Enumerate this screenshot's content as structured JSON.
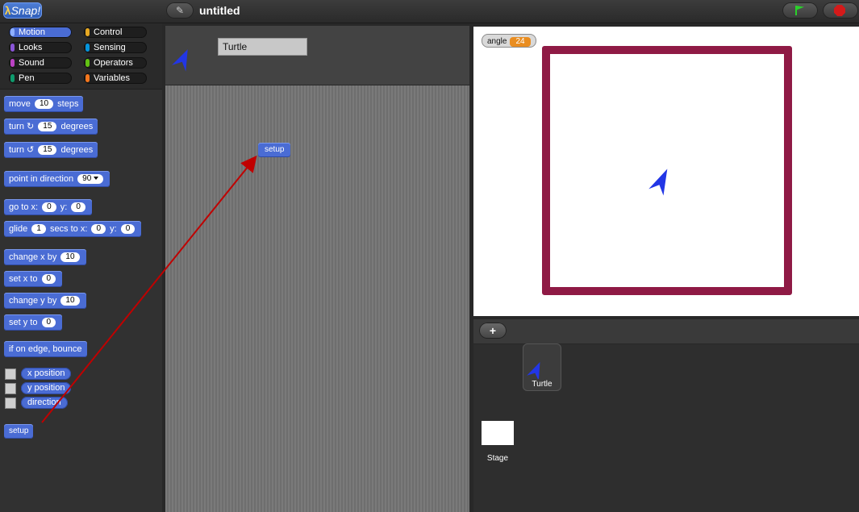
{
  "header": {
    "logo": "Snap!",
    "project_title": "untitled",
    "pencil_icon": "pencil-icon",
    "flag_icon": "green-flag-icon",
    "stop_icon": "stop-sign-icon"
  },
  "categories": [
    {
      "label": "Motion",
      "color": "#4a6cd4",
      "active": true
    },
    {
      "label": "Looks",
      "color": "#8a55d7"
    },
    {
      "label": "Sound",
      "color": "#bb42c3"
    },
    {
      "label": "Pen",
      "color": "#0e9a6c"
    },
    {
      "label": "Control",
      "color": "#e6a822"
    },
    {
      "label": "Sensing",
      "color": "#0494dc"
    },
    {
      "label": "Operators",
      "color": "#62c213"
    },
    {
      "label": "Variables",
      "color": "#f3761d"
    }
  ],
  "blocks": {
    "move": {
      "pre": "move",
      "val": "10",
      "post": "steps"
    },
    "turn_cw": {
      "pre": "turn ↻",
      "val": "15",
      "post": "degrees"
    },
    "turn_ccw": {
      "pre": "turn ↺",
      "val": "15",
      "post": "degrees"
    },
    "point": {
      "pre": "point in direction",
      "val": "90"
    },
    "goto": {
      "pre": "go to x:",
      "x": "0",
      "mid": "y:",
      "y": "0"
    },
    "glide": {
      "pre": "glide",
      "val": "1",
      "mid1": "secs to x:",
      "x": "0",
      "mid2": "y:",
      "y": "0"
    },
    "change_x": {
      "pre": "change x by",
      "val": "10"
    },
    "set_x": {
      "pre": "set x to",
      "val": "0"
    },
    "change_y": {
      "pre": "change y by",
      "val": "10"
    },
    "set_y": {
      "pre": "set y to",
      "val": "0"
    },
    "bounce": "if on edge, bounce",
    "x_position": "x position",
    "y_position": "y position",
    "direction": "direction",
    "setup": "setup"
  },
  "sprite": {
    "name": "Turtle"
  },
  "scripts": {
    "setup_block": "setup"
  },
  "stage": {
    "watcher": {
      "label": "angle",
      "value": "24"
    },
    "square_color": "#8f1a45",
    "turtle_color": "#2236e6"
  },
  "corral": {
    "add_label": "+",
    "sprite_label": "Turtle",
    "stage_label": "Stage"
  }
}
